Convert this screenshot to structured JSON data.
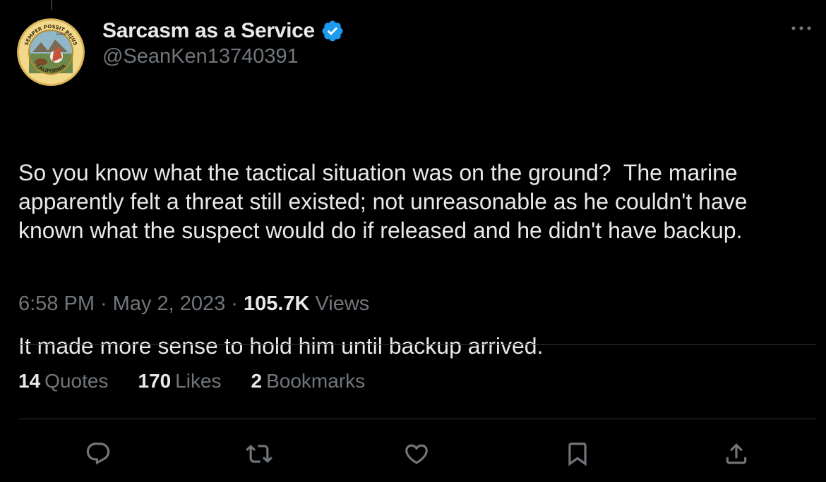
{
  "author": {
    "display_name": "Sarcasm as a Service",
    "handle": "@SeanKen13740391",
    "verified": true,
    "avatar_seal_text_top": "SEMPER POSSIT PEJUS",
    "avatar_seal_text_bottom": "CALIFORNIA",
    "avatar_seal_text_eureka": "EUREKA"
  },
  "tweet": {
    "paragraph_1": "So you know what the tactical situation was on the ground?  The marine apparently felt a threat still existed; not unreasonable as he couldn't have known what the suspect would do if released and he didn't have backup.",
    "paragraph_2": "It made more sense to hold him until backup arrived."
  },
  "meta": {
    "time": "6:58 PM",
    "separator": "·",
    "date": "May 2, 2023",
    "views_count": "105.7K",
    "views_label": "Views"
  },
  "stats": {
    "quotes_count": "14",
    "quotes_label": "Quotes",
    "likes_count": "170",
    "likes_label": "Likes",
    "bookmarks_count": "2",
    "bookmarks_label": "Bookmarks"
  },
  "icons": {
    "more": "more-horizontal-icon",
    "verified": "verified-badge-icon",
    "reply": "reply-icon",
    "retweet": "retweet-icon",
    "like": "heart-icon",
    "bookmark": "bookmark-icon",
    "share": "share-icon"
  },
  "colors": {
    "background": "#000000",
    "primary_text": "#e7e9ea",
    "secondary_text": "#71767b",
    "divider": "#2f3336",
    "verified_blue": "#1d9bf0"
  }
}
